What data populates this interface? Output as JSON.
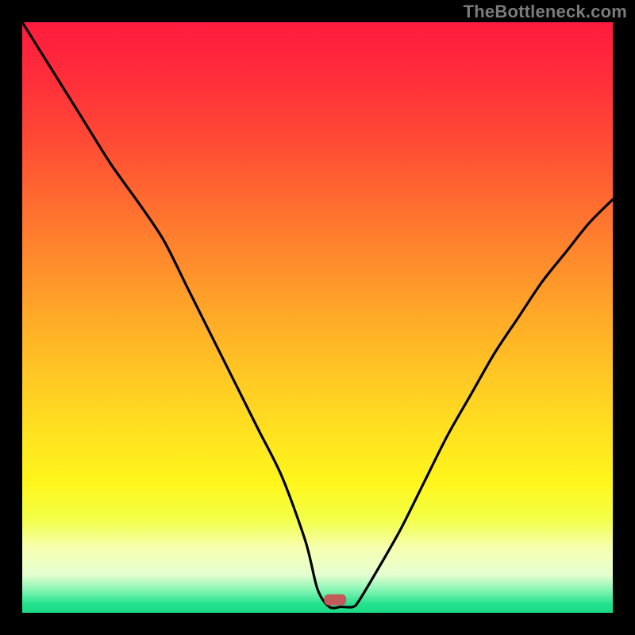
{
  "watermark": {
    "text": "TheBottleneck.com"
  },
  "chart_data": {
    "type": "line",
    "title": "",
    "xlabel": "",
    "ylabel": "",
    "xlim": [
      0,
      100
    ],
    "ylim": [
      0,
      100
    ],
    "grid": false,
    "legend": false,
    "background": {
      "stops": [
        {
          "offset": 0.0,
          "color": "#ff1b3f"
        },
        {
          "offset": 0.1,
          "color": "#ff2f3a"
        },
        {
          "offset": 0.2,
          "color": "#ff4a35"
        },
        {
          "offset": 0.3,
          "color": "#ff6a30"
        },
        {
          "offset": 0.4,
          "color": "#ff8a2c"
        },
        {
          "offset": 0.5,
          "color": "#ffaa28"
        },
        {
          "offset": 0.6,
          "color": "#ffc824"
        },
        {
          "offset": 0.7,
          "color": "#ffe320"
        },
        {
          "offset": 0.78,
          "color": "#fff61c"
        },
        {
          "offset": 0.84,
          "color": "#f3ff45"
        },
        {
          "offset": 0.89,
          "color": "#f6ffb0"
        },
        {
          "offset": 0.935,
          "color": "#e6ffd0"
        },
        {
          "offset": 0.96,
          "color": "#8cf6b6"
        },
        {
          "offset": 0.985,
          "color": "#24e38f"
        },
        {
          "offset": 1.0,
          "color": "#1bd984"
        }
      ]
    },
    "series": [
      {
        "name": "bottleneck-curve",
        "x": [
          0,
          5,
          10,
          15,
          20,
          24,
          28,
          32,
          36,
          40,
          44,
          48,
          50,
          52,
          54,
          56,
          57,
          60,
          64,
          68,
          72,
          76,
          80,
          84,
          88,
          92,
          96,
          100
        ],
        "y": [
          100,
          92,
          84,
          76,
          69,
          63,
          55,
          47,
          39,
          31,
          23,
          12,
          4,
          1,
          1,
          1,
          2,
          7,
          14,
          22,
          30,
          37,
          44,
          50,
          56,
          61,
          66,
          70
        ]
      }
    ],
    "marker": {
      "x": 53,
      "y": 2.2,
      "color": "#c25a5c"
    }
  }
}
